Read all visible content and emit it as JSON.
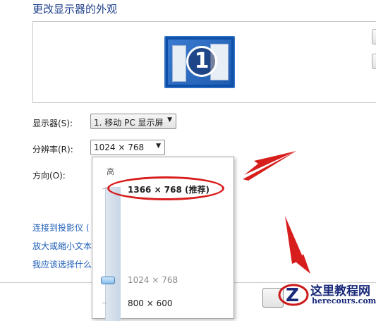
{
  "title": "更改显示器的外观",
  "monitor_number": "1",
  "display": {
    "label": "显示器(S):",
    "value": "1. 移动 PC 显示屏"
  },
  "resolution": {
    "label": "分辨率(R):",
    "value": "1024 × 768"
  },
  "orientation": {
    "label": "方向(O):"
  },
  "links": [
    "连接到投影仪 (",
    "放大或缩小文本",
    "我应该选择什么"
  ],
  "dropdown": {
    "high_label": "高",
    "options": [
      {
        "label": "1366 × 768 (推荐)",
        "bold": true
      },
      {
        "label": "1024 × 768",
        "bold": false
      },
      {
        "label": "800 × 600",
        "bold": false
      }
    ],
    "slider_fraction": 0.5
  },
  "watermark": {
    "cn": "这里教程网",
    "en": "herecours.com",
    "letter": "Z"
  },
  "colors": {
    "accent": "#1e3f8a",
    "link": "#1e5eb8",
    "annotation": "#d81d1d"
  }
}
